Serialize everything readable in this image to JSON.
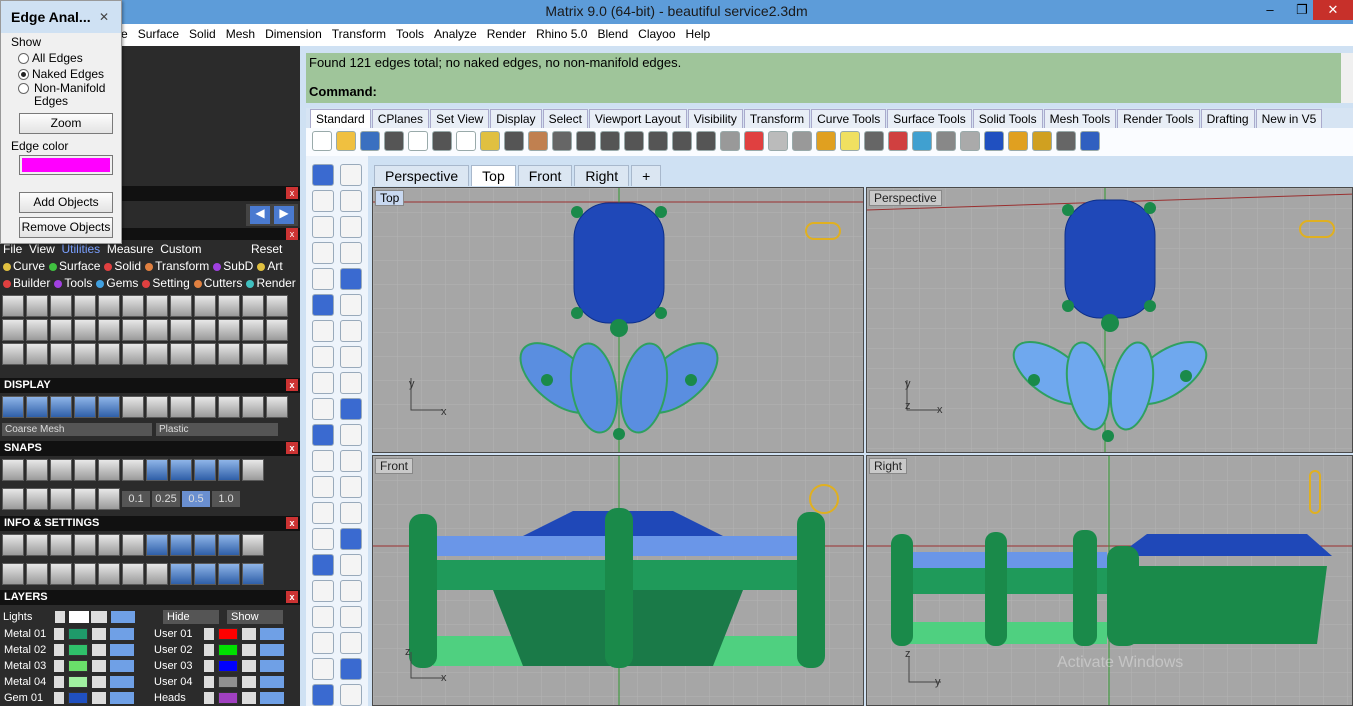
{
  "window": {
    "title": "Matrix 9.0 (64-bit) - beautiful service2.3dm",
    "controls": [
      "–",
      "❐",
      "✕"
    ]
  },
  "menubar": [
    "e",
    "Surface",
    "Solid",
    "Mesh",
    "Dimension",
    "Transform",
    "Tools",
    "Analyze",
    "Render",
    "Rhino 5.0",
    "Blend",
    "Clayoo",
    "Help"
  ],
  "edge_dialog": {
    "title": "Edge Anal...",
    "show_label": "Show",
    "options": [
      "All Edges",
      "Naked Edges",
      "Non-Manifold Edges"
    ],
    "selected": "Naked Edges",
    "zoom_button": "Zoom",
    "edge_color_label": "Edge color",
    "edge_color": "#ff00ff",
    "add_objects_button": "Add Objects",
    "remove_objects_button": "Remove Objects"
  },
  "command": {
    "message": "Found 121 edges total; no naked edges, no non-manifold edges.",
    "prompt": "Command:"
  },
  "toolbar_tabs": [
    "Standard",
    "CPlanes",
    "Set View",
    "Display",
    "Select",
    "Viewport Layout",
    "Visibility",
    "Transform",
    "Curve Tools",
    "Surface Tools",
    "Solid Tools",
    "Mesh Tools",
    "Render Tools",
    "Drafting",
    "New in V5"
  ],
  "active_toolbar_tab": "Standard",
  "viewport_tabs": [
    "Perspective",
    "Top",
    "Front",
    "Right",
    "+"
  ],
  "active_viewport_tab": "Top",
  "viewports": {
    "top": {
      "label": "Top",
      "axis_x": "x",
      "axis_y": "y"
    },
    "perspective": {
      "label": "Perspective",
      "axis_x": "x",
      "axis_y": "y",
      "axis_z": "z"
    },
    "front": {
      "label": "Front",
      "axis_x": "x",
      "axis_z": "z"
    },
    "right": {
      "label": "Right",
      "axis_y": "y",
      "axis_z": "z"
    }
  },
  "left_panel": {
    "menu": [
      "File",
      "View",
      "Utilities",
      "Measure",
      "Custom",
      "Reset"
    ],
    "categories_row1": [
      {
        "label": "Curve",
        "color": "#e0c040"
      },
      {
        "label": "Surface",
        "color": "#40c040"
      },
      {
        "label": "Solid",
        "color": "#e04040"
      },
      {
        "label": "Transform",
        "color": "#e08040"
      },
      {
        "label": "SubD",
        "color": "#a040e0"
      },
      {
        "label": "Art",
        "color": "#e0c040"
      }
    ],
    "categories_row2": [
      {
        "label": "Builder",
        "color": "#e04040"
      },
      {
        "label": "Tools",
        "color": "#a040e0"
      },
      {
        "label": "Gems",
        "color": "#40a0e0"
      },
      {
        "label": "Setting",
        "color": "#e04040"
      },
      {
        "label": "Cutters",
        "color": "#e08040"
      },
      {
        "label": "Render",
        "color": "#40c0c0"
      }
    ],
    "display_title": "DISPLAY",
    "display_mesh": "Coarse Mesh",
    "display_material": "Plastic",
    "snaps_title": "SNAPS",
    "snap_values": [
      "0.1",
      "0.25",
      "0.5",
      "1.0"
    ],
    "info_title": "INFO & SETTINGS",
    "layers_title": "LAYERS",
    "lights_label": "Lights",
    "hide_label": "Hide",
    "show_label": "Show",
    "layers_left": [
      {
        "name": "Metal 01",
        "color": "#1f9a6a"
      },
      {
        "name": "Metal 02",
        "color": "#2fc06a"
      },
      {
        "name": "Metal 03",
        "color": "#6ae06a"
      },
      {
        "name": "Metal 04",
        "color": "#a0f0a0"
      },
      {
        "name": "Gem 01",
        "color": "#2050c0"
      }
    ],
    "layers_right": [
      {
        "name": "User 01",
        "color": "#ff0000"
      },
      {
        "name": "User 02",
        "color": "#00e000"
      },
      {
        "name": "User 03",
        "color": "#0000ff"
      },
      {
        "name": "User 04",
        "color": "#909090"
      },
      {
        "name": "Heads",
        "color": "#a040c0"
      }
    ]
  },
  "watermark": "Activate Windows"
}
